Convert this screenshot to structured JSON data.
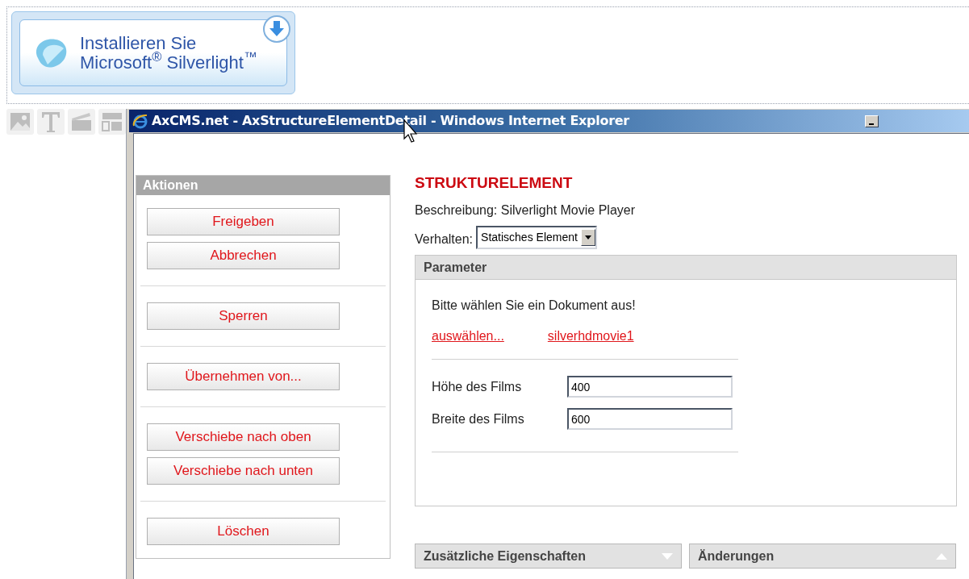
{
  "silverlight_badge": {
    "line1": "Installieren Sie",
    "line2": "Microsoft$^{®}$ Silverlight$^{™}$"
  },
  "window": {
    "title": "AxCMS.net - AxStructureElementDetail - Windows Internet Explorer"
  },
  "actions": {
    "title": "Aktionen",
    "groups": [
      [
        "Freigeben",
        "Abbrechen"
      ],
      [
        "Sperren"
      ],
      [
        "Übernehmen von..."
      ],
      [
        "Verschiebe nach oben",
        "Verschiebe nach unten"
      ],
      [
        "Löschen"
      ]
    ]
  },
  "content": {
    "heading": "STRUKTURELEMENT",
    "description": "Beschreibung: Silverlight Movie Player",
    "behavior_label": "Verhalten:",
    "behavior_value": "Statisches Element",
    "parameter_panel": {
      "title": "Parameter",
      "prompt": "Bitte wählen Sie ein Dokument aus!",
      "links": [
        "auswählen...",
        "silverhdmovie1"
      ],
      "fields": [
        {
          "label": "Höhe des Films",
          "value": "400"
        },
        {
          "label": "Breite des Films",
          "value": "600"
        }
      ]
    },
    "bottom_panels": [
      {
        "title": "Zusätzliche Eigenschaften",
        "expanded": false
      },
      {
        "title": "Änderungen",
        "expanded": true
      }
    ]
  }
}
